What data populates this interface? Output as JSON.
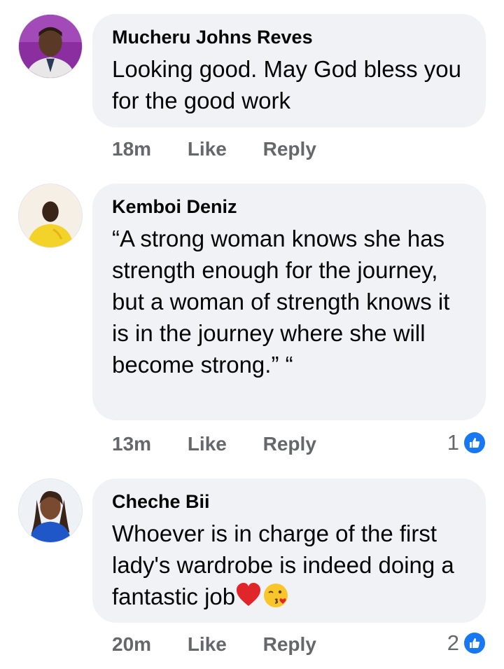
{
  "comments": [
    {
      "author": "Mucheru Johns Reves",
      "text": "Looking good. May God bless you for the good work",
      "time": "18m",
      "like_label": "Like",
      "reply_label": "Reply",
      "reaction_count": ""
    },
    {
      "author": "Kemboi Deniz",
      "text": "“A strong woman knows she has strength enough for the journey, but a woman of strength knows it is in the journey where she will become strong.” “",
      "time": "13m",
      "like_label": "Like",
      "reply_label": "Reply",
      "reaction_count": "1"
    },
    {
      "author": "Cheche Bii",
      "text": "Whoever is in charge of the first lady's wardrobe is indeed doing a fantastic job",
      "time": "20m",
      "like_label": "Like",
      "reply_label": "Reply",
      "reaction_count": "2",
      "trailing_emojis": [
        "heart-emoji",
        "kissing-face-emoji"
      ]
    }
  ],
  "colors": {
    "bubble": "#f0f2f5",
    "meta_text": "#65676b",
    "like_blue": "#1877f2"
  }
}
